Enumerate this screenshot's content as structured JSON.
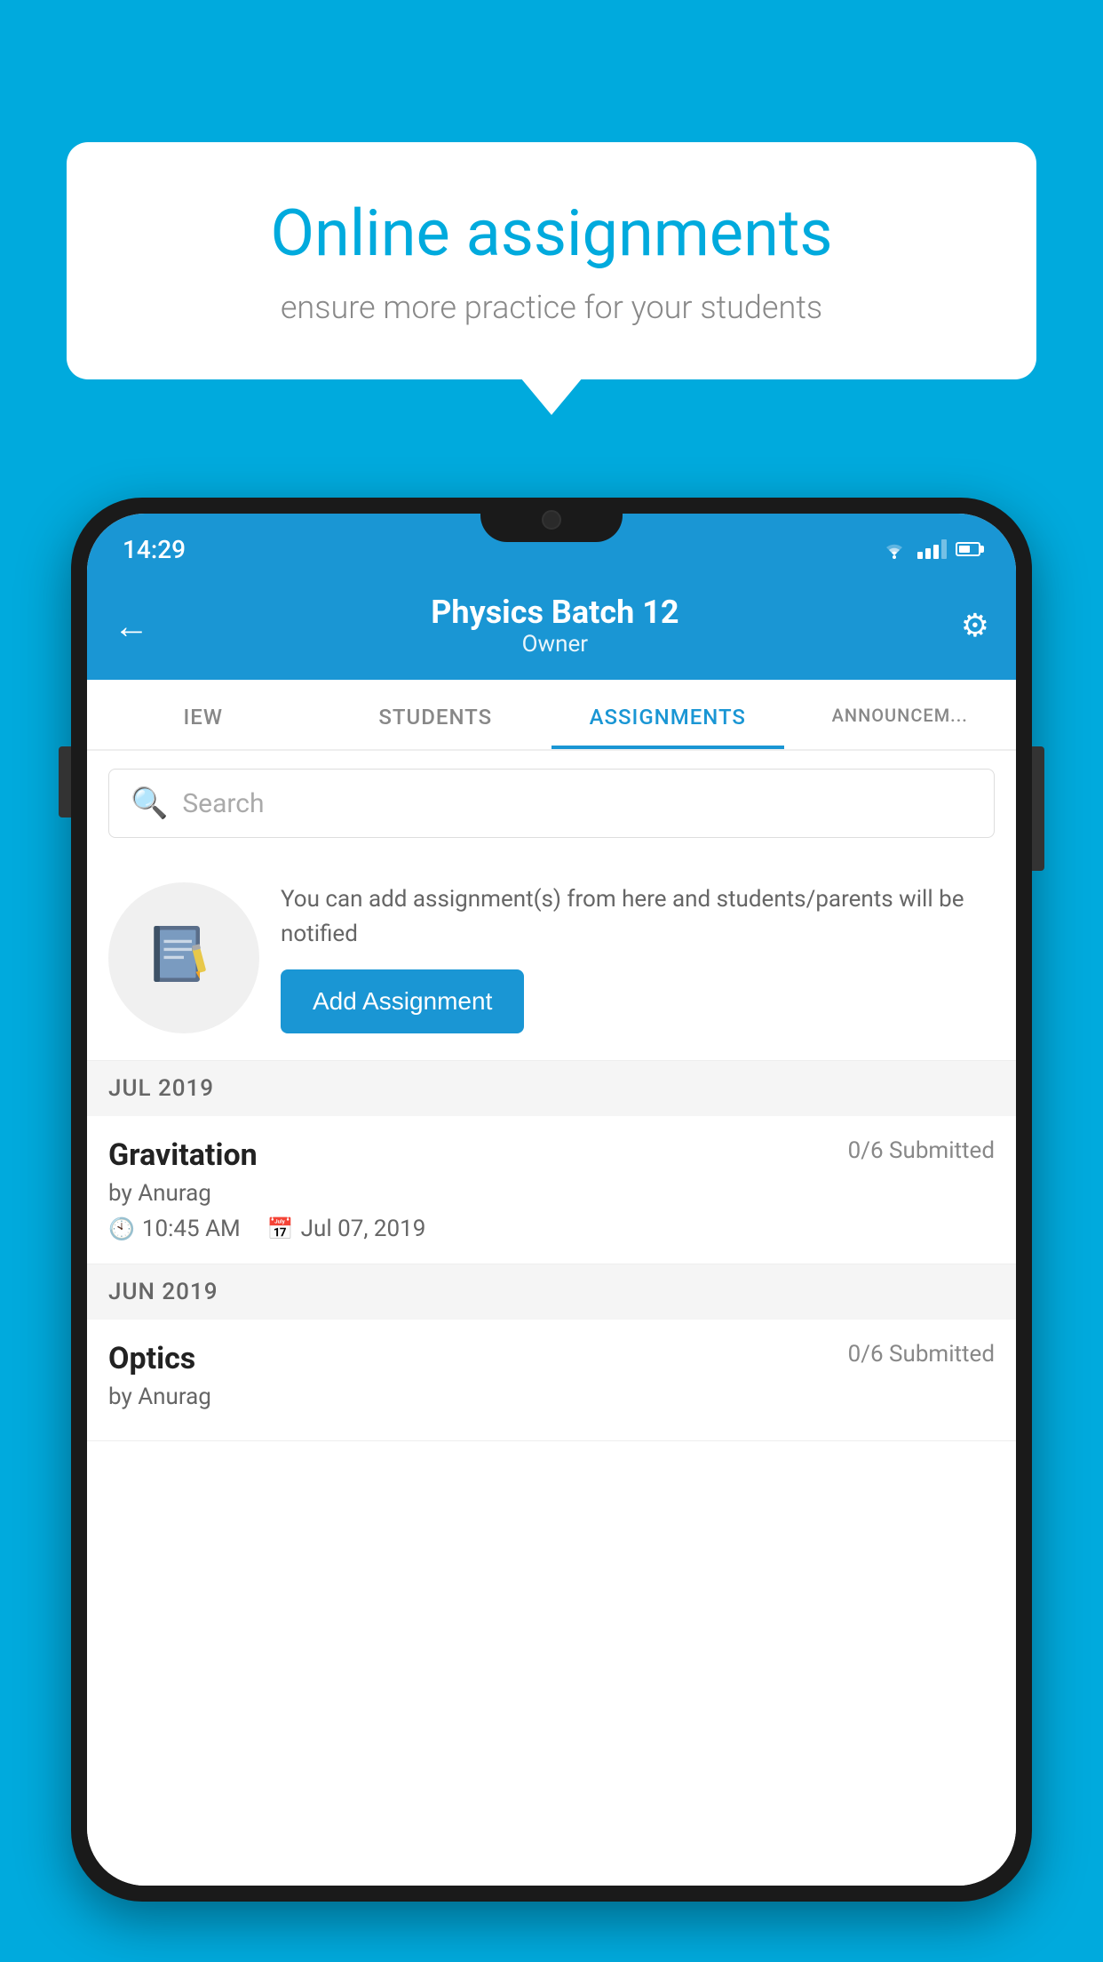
{
  "background_color": "#00AADD",
  "speech_bubble": {
    "title": "Online assignments",
    "subtitle": "ensure more practice for your students"
  },
  "status_bar": {
    "time": "14:29"
  },
  "app_bar": {
    "title": "Physics Batch 12",
    "subtitle": "Owner",
    "back_label": "←",
    "settings_label": "⚙"
  },
  "tabs": [
    {
      "label": "IEW",
      "active": false
    },
    {
      "label": "STUDENTS",
      "active": false
    },
    {
      "label": "ASSIGNMENTS",
      "active": true
    },
    {
      "label": "ANNOUNCEM...",
      "active": false
    }
  ],
  "search": {
    "placeholder": "Search"
  },
  "promo": {
    "text": "You can add assignment(s) from here and students/parents will be notified",
    "button_label": "Add Assignment"
  },
  "sections": [
    {
      "month": "JUL 2019",
      "assignments": [
        {
          "title": "Gravitation",
          "submitted": "0/6 Submitted",
          "by": "by Anurag",
          "time": "10:45 AM",
          "date": "Jul 07, 2019"
        }
      ]
    },
    {
      "month": "JUN 2019",
      "assignments": [
        {
          "title": "Optics",
          "submitted": "0/6 Submitted",
          "by": "by Anurag",
          "time": "",
          "date": ""
        }
      ]
    }
  ]
}
